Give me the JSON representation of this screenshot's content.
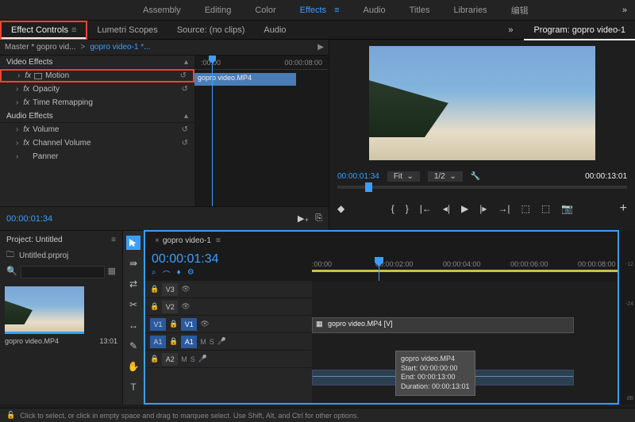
{
  "topTabs": {
    "assembly": "Assembly",
    "editing": "Editing",
    "color": "Color",
    "effects": "Effects",
    "audio": "Audio",
    "titles": "Titles",
    "libraries": "Libraries",
    "edit_cjk": "编辑"
  },
  "panels": {
    "effectControls": "Effect Controls",
    "lumetriScopes": "Lumetri Scopes",
    "source": "Source: (no clips)",
    "audioMixer": "Audio",
    "program": "Program: gopro video-1"
  },
  "ec": {
    "master": "Master * gopro vid...",
    "clip": "gopro video-1 *...",
    "clipbar": "gopro video.MP4",
    "ruler0": ":00:00",
    "ruler1": "00:00:08:00",
    "videoEffects": "Video Effects",
    "motion": "Motion",
    "opacity": "Opacity",
    "timeRemap": "Time Remapping",
    "audioEffects": "Audio Effects",
    "volume": "Volume",
    "channelVolume": "Channel Volume",
    "panner": "Panner",
    "timecode": "00:00:01:34"
  },
  "prog": {
    "tc": "00:00:01:34",
    "fit": "Fit",
    "half": "1/2",
    "dur": "00:00:13:01"
  },
  "project": {
    "title": "Project: Untitled",
    "file": "Untitled.prproj",
    "clipName": "gopro video.MP4",
    "clipDur": "13:01"
  },
  "seq": {
    "name": "gopro video-1",
    "tc": "00:00:01:34",
    "ticks": [
      ":00:00",
      "00:00:02:00",
      "00:00:04:00",
      "00:00:06:00",
      "00:00:08:00"
    ],
    "vclip": "gopro video.MP4 [V]",
    "v1": "V1",
    "v2": "V2",
    "v3": "V3",
    "a1": "A1",
    "a2": "A2"
  },
  "tooltip": {
    "name": "gopro video.MP4",
    "start": "Start: 00:00:00:00",
    "end": "End: 00:00:13:00",
    "dur": "Duration: 00:00:13:01"
  },
  "meters": {
    "m12": "-12",
    "m24": "-24",
    "dB": "dB"
  },
  "status": "Click to select, or click in empty space and drag to marquee select. Use Shift, Alt, and Ctrl for other options."
}
